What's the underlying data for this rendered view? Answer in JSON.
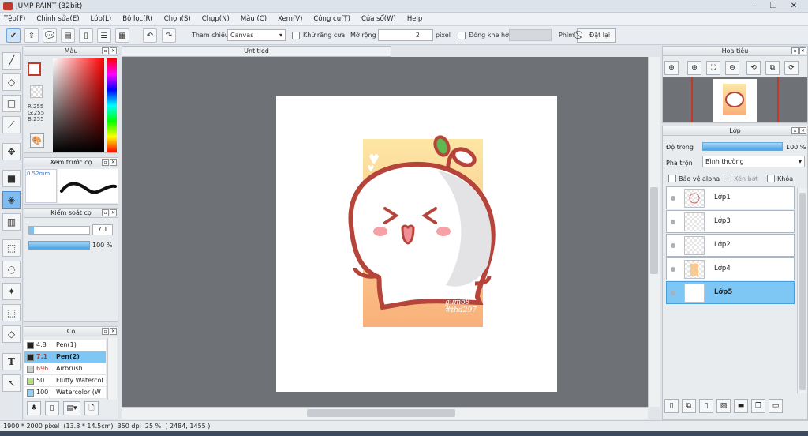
{
  "app": {
    "title": "JUMP PAINT (32bit)"
  },
  "window_controls": {
    "minimize": "–",
    "restore": "❐",
    "close": "✕"
  },
  "menu": [
    "Tệp(F)",
    "Chỉnh sửa(E)",
    "Lớp(L)",
    "Bộ lọc(R)",
    "Chọn(S)",
    "Chụp(N)",
    "Màu (C)",
    "Xem(V)",
    "Công cụ(T)",
    "Cửa sổ(W)",
    "Help"
  ],
  "toolbar": {
    "reference_label": "Tham chiếu",
    "reference_value": "Canvas",
    "antialias_label": "Khử răng cưa",
    "expand_label": "Mở rộng",
    "expand_value": "2",
    "expand_unit": "pixel",
    "close_gap_label": "Đóng khe hở",
    "key_label": "Phím",
    "reset_label": "Đặt lại"
  },
  "color_panel": {
    "title": "Màu",
    "r": "R:255",
    "g": "G:255",
    "b": "B:255",
    "primary": "#c0392b",
    "secondary": "#000000"
  },
  "brush_preview_panel": {
    "title": "Xem trước cọ",
    "size": "0.52mm"
  },
  "brush_control_panel": {
    "title": "Kiểm soát cọ",
    "size_value": "7.1",
    "opacity_value": "100 %"
  },
  "brush_panel": {
    "title": "Cọ",
    "items": [
      {
        "size": "4.8",
        "name": "Pen(1)",
        "color": "#222222"
      },
      {
        "size": "7.1",
        "name": "Pen(2)",
        "color": "#222222"
      },
      {
        "size": "696",
        "name": "Airbrush",
        "color": "#cccccc"
      },
      {
        "size": "50",
        "name": "Fluffy Watercol",
        "color": "#b5e27a"
      },
      {
        "size": "100",
        "name": "Watercolor (W",
        "color": "#8fd3f0"
      }
    ]
  },
  "document": {
    "tab": "Untitled"
  },
  "artwork": {
    "signature_line1": "gumo8",
    "signature_line2": "#thd297"
  },
  "navigator_panel": {
    "title": "Hoa tiêu"
  },
  "layer_panel": {
    "title": "Lớp",
    "opacity_label": "Độ trong",
    "opacity_value": "100 %",
    "blend_label": "Pha trộn",
    "blend_value": "Bình thường",
    "protect_alpha": "Bảo vệ alpha",
    "clip": "Xén bớt",
    "lock": "Khóa",
    "layers": [
      {
        "name": "Lớp1"
      },
      {
        "name": "Lớp3"
      },
      {
        "name": "Lớp2"
      },
      {
        "name": "Lớp4"
      },
      {
        "name": "Lớp5"
      }
    ]
  },
  "status": {
    "text": "1900 * 2000 pixel  (13.8 * 14.5cm)  350 dpi  25 %  ( 2484, 1455 )"
  }
}
